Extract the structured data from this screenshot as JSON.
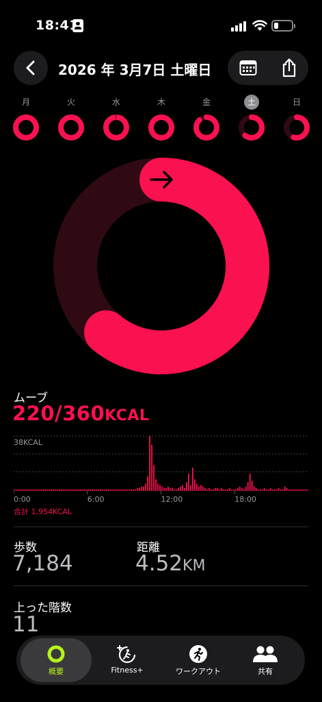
{
  "status_bar": {
    "time": "18:41"
  },
  "header": {
    "title": "2026 年 3月7日 土曜日"
  },
  "week": [
    {
      "label": "月",
      "progress": 0.98,
      "selected": false
    },
    {
      "label": "火",
      "progress": 1.0,
      "selected": false
    },
    {
      "label": "水",
      "progress": 0.99,
      "selected": false
    },
    {
      "label": "木",
      "progress": 0.98,
      "selected": false
    },
    {
      "label": "金",
      "progress": 0.88,
      "selected": false
    },
    {
      "label": "土",
      "progress": 0.61,
      "selected": true
    },
    {
      "label": "日",
      "progress": 0.55,
      "selected": false
    }
  ],
  "move": {
    "title": "ムーブ",
    "value": "220/360",
    "unit": "KCAL",
    "progress": 0.611
  },
  "chart_data": {
    "type": "bar",
    "ylabel": "38KCAL",
    "ymax": 38,
    "x_ticks": [
      "0:00",
      "6:00",
      "12:00",
      "18:00"
    ],
    "total_label": "合計 1,954KCAL",
    "values": [
      1,
      1,
      1,
      1,
      1,
      1,
      1,
      1,
      1,
      1,
      1,
      1,
      1,
      1,
      1,
      1,
      1,
      1,
      1,
      1,
      1,
      1,
      1,
      1,
      1,
      1,
      1,
      1,
      1,
      1,
      1,
      1,
      1,
      1,
      1,
      1,
      1,
      1,
      1,
      1,
      1,
      1,
      1,
      1,
      1,
      1,
      1,
      1,
      1,
      1,
      1,
      1,
      1,
      1,
      1,
      1,
      1,
      1,
      1,
      1,
      2,
      2,
      3,
      3,
      5,
      10,
      38,
      32,
      18,
      8,
      5,
      4,
      3,
      2,
      2,
      3,
      2,
      2,
      1,
      1,
      2,
      3,
      4,
      2,
      6,
      12,
      4,
      16,
      8,
      5,
      3,
      4,
      3,
      2,
      1,
      2,
      1,
      1,
      2,
      2,
      1,
      2,
      1,
      1,
      1,
      2,
      1,
      1,
      1,
      2,
      3,
      2,
      1,
      3,
      6,
      12,
      7,
      3,
      2,
      1,
      1,
      1,
      2,
      1,
      1,
      2,
      1,
      1,
      1,
      2,
      1,
      1,
      3,
      2,
      1,
      1,
      1,
      1,
      1,
      1,
      1,
      1,
      1,
      1
    ]
  },
  "stats": {
    "steps_label": "歩数",
    "steps_value": "7,184",
    "distance_label": "距離",
    "distance_value": "4.52",
    "distance_unit": "KM",
    "floors_label": "上った階数",
    "floors_value": "11"
  },
  "tabs": [
    {
      "label": "概要",
      "icon": "activity-ring-icon",
      "active": true
    },
    {
      "label": "Fitness+",
      "icon": "fitness-plus-icon",
      "active": false
    },
    {
      "label": "ワークアウト",
      "icon": "workout-runner-icon",
      "active": false
    },
    {
      "label": "共有",
      "icon": "sharing-people-icon",
      "active": false
    }
  ],
  "colors": {
    "move_red": "#fa114f",
    "move_dark": "#2f0a13",
    "accent_green": "#b5f41b"
  }
}
